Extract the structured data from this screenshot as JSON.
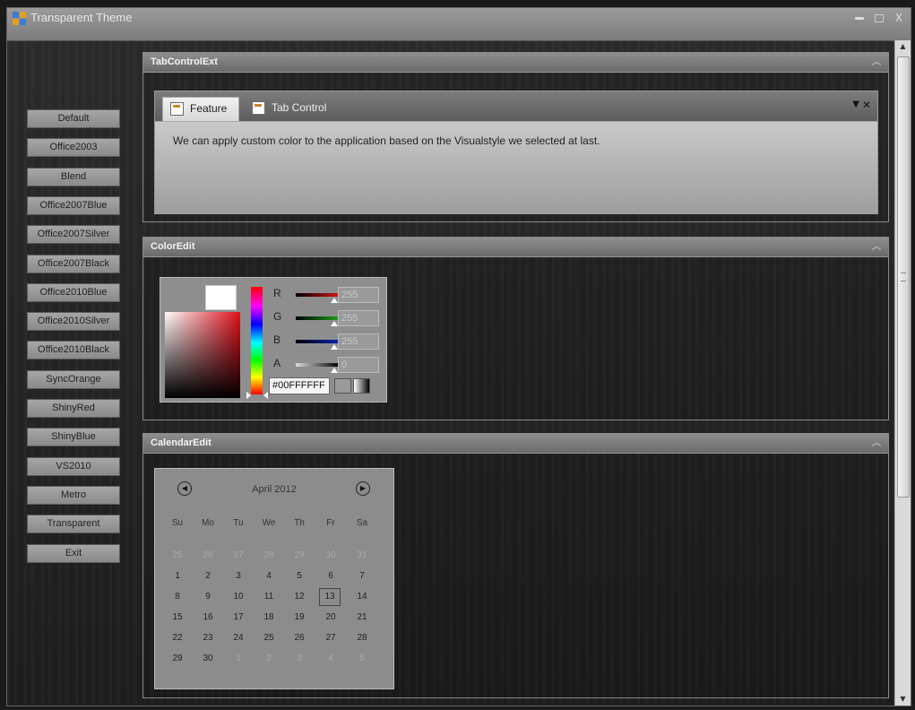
{
  "window": {
    "title": "Transparent Theme",
    "controls": [
      "minimize",
      "maximize",
      "close"
    ]
  },
  "sidebar": {
    "buttons": [
      "Default",
      "Office2003",
      "Blend",
      "Office2007Blue",
      "Office2007Silver",
      "Office2007Black",
      "Office2010Blue",
      "Office2010Silver",
      "Office2010Black",
      "SyncOrange",
      "ShinyRed",
      "ShinyBlue",
      "VS2010",
      "Metro",
      "Transparent",
      "Exit"
    ]
  },
  "tabgroup": {
    "header": "TabControlExt",
    "tabs": [
      {
        "label": "Feature",
        "selected": true
      },
      {
        "label": "Tab Control",
        "selected": false
      }
    ],
    "content": "We can apply custom color to the application based on the Visualstyle we selected at last."
  },
  "colorgroup": {
    "header": "ColorEdit",
    "channels": [
      {
        "label": "R",
        "value": "255",
        "color": "#d01818"
      },
      {
        "label": "G",
        "value": "255",
        "color": "#18a018"
      },
      {
        "label": "B",
        "value": "255",
        "color": "#1020b0"
      },
      {
        "label": "A",
        "value": "0",
        "color": "#444444"
      }
    ],
    "hex": "#00FFFFFF"
  },
  "calendargroup": {
    "header": "CalendarEdit",
    "month": "April 2012",
    "weekdays": [
      "Su",
      "Mo",
      "Tu",
      "We",
      "Th",
      "Fr",
      "Sa"
    ],
    "weeks": [
      [
        "25",
        "26",
        "27",
        "28",
        "29",
        "30",
        "31"
      ],
      [
        "1",
        "2",
        "3",
        "4",
        "5",
        "6",
        "7"
      ],
      [
        "8",
        "9",
        "10",
        "11",
        "12",
        "13",
        "14"
      ],
      [
        "15",
        "16",
        "17",
        "18",
        "19",
        "20",
        "21"
      ],
      [
        "22",
        "23",
        "24",
        "25",
        "26",
        "27",
        "28"
      ],
      [
        "29",
        "30",
        "1",
        "2",
        "3",
        "4",
        "5"
      ]
    ],
    "selected_day": "13"
  }
}
